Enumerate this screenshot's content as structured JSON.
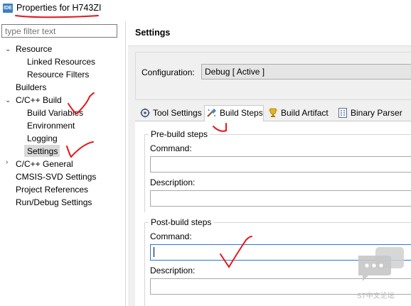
{
  "window": {
    "icon_text": "IDE",
    "title": "Properties for H743ZI"
  },
  "filter": {
    "placeholder": "type filter text"
  },
  "tree": {
    "items": [
      {
        "label": "Resource",
        "expanded": true
      },
      {
        "label": "Linked Resources"
      },
      {
        "label": "Resource Filters"
      },
      {
        "label": "Builders"
      },
      {
        "label": "C/C++ Build",
        "expanded": true
      },
      {
        "label": "Build Variables"
      },
      {
        "label": "Environment"
      },
      {
        "label": "Logging"
      },
      {
        "label": "Settings",
        "selected": true
      },
      {
        "label": "C/C++ General",
        "expanded": false
      },
      {
        "label": "CMSIS-SVD Settings"
      },
      {
        "label": "Project References"
      },
      {
        "label": "Run/Debug Settings"
      }
    ]
  },
  "main": {
    "title": "Settings",
    "configuration": {
      "label": "Configuration:",
      "value": "Debug  [ Active ]"
    },
    "tabs": [
      {
        "label": "Tool Settings",
        "icon": "tool-settings-icon"
      },
      {
        "label": "Build Steps",
        "icon": "build-steps-icon",
        "active": true
      },
      {
        "label": "Build Artifact",
        "icon": "build-artifact-icon"
      },
      {
        "label": "Binary Parser",
        "icon": "binary-parser-icon"
      }
    ],
    "pre_build": {
      "title": "Pre-build steps",
      "command_label": "Command:",
      "command_value": "",
      "description_label": "Description:",
      "description_value": ""
    },
    "post_build": {
      "title": "Post-build steps",
      "command_label": "Command:",
      "command_value": "",
      "description_label": "Description:",
      "description_value": ""
    }
  },
  "watermark": {
    "text": "ST中文论坛"
  },
  "colors": {
    "annotation": "#e8141a",
    "focus_border": "#2c77d1",
    "selection": "#d9d9d9",
    "icon_blue": "#3d7fc1"
  }
}
